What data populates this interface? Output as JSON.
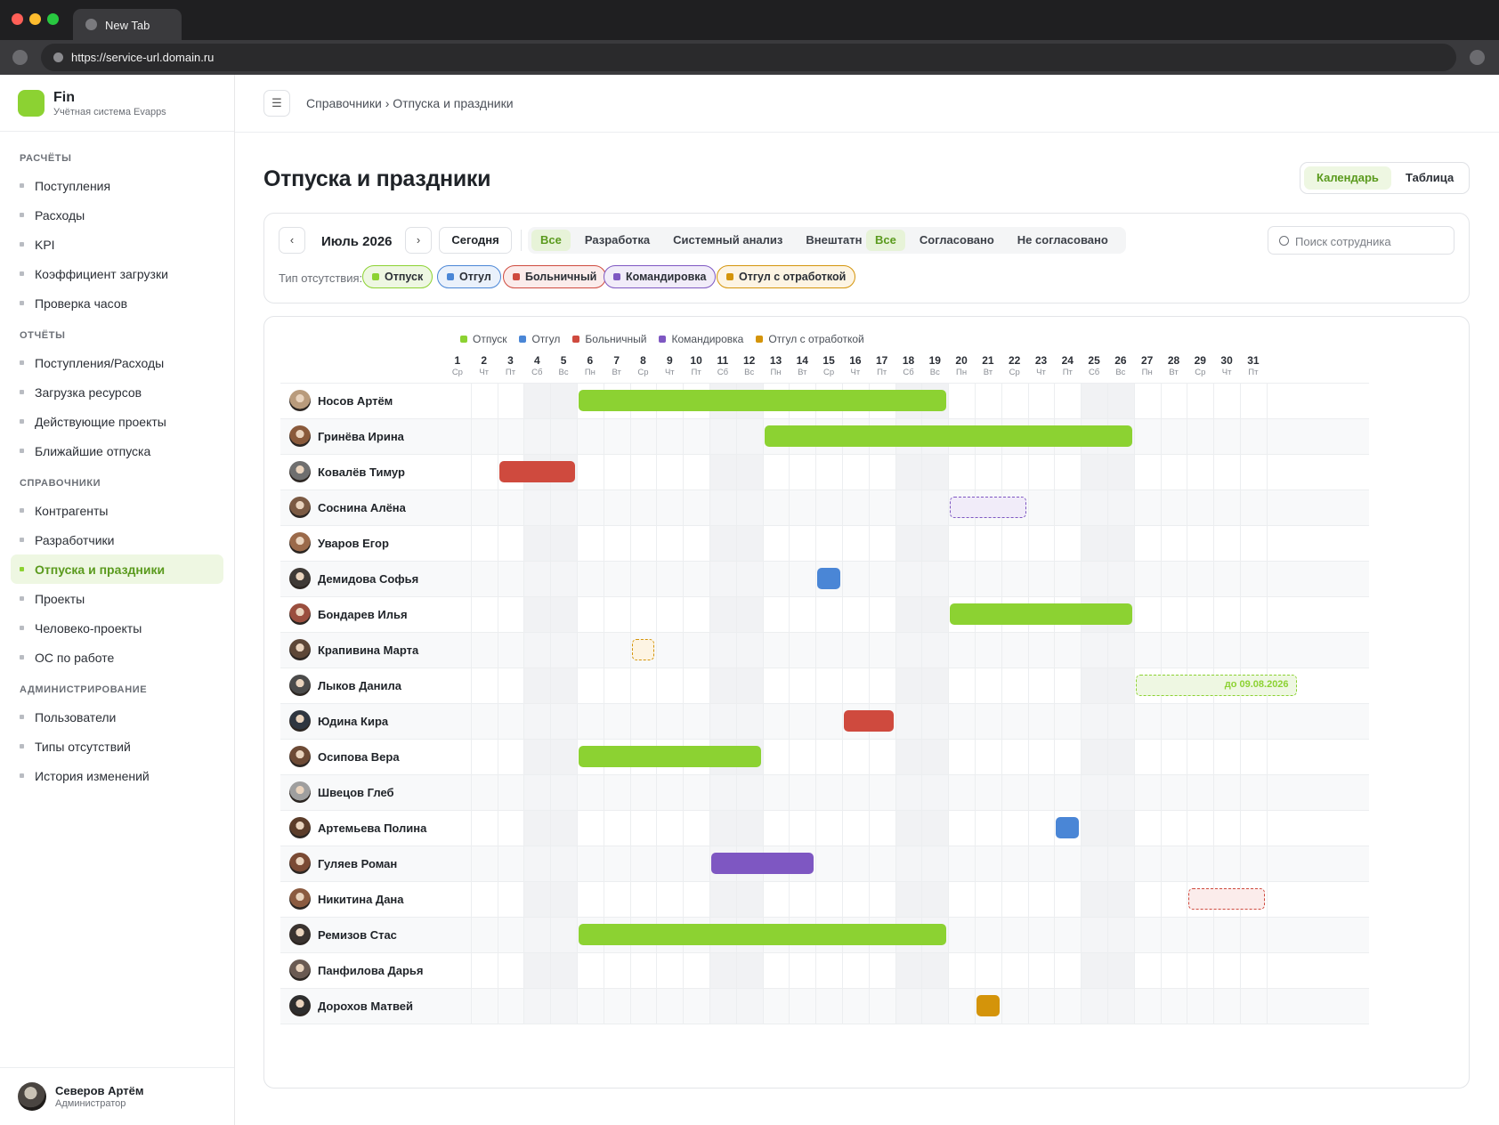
{
  "browser": {
    "tab_title": "New Tab",
    "url": "https://service-url.domain.ru"
  },
  "brand": {
    "name": "Fin",
    "subtitle": "Учётная система Evapps"
  },
  "sidebar": {
    "sections": [
      {
        "title": "РАСЧЁТЫ",
        "items": [
          "Поступления",
          "Расходы",
          "KPI",
          "Коэффициент загрузки",
          "Проверка часов"
        ]
      },
      {
        "title": "ОТЧЁТЫ",
        "items": [
          "Поступления/Расходы",
          "Загрузка ресурсов",
          "Действующие проекты",
          "Ближайшие отпуска"
        ]
      },
      {
        "title": "СПРАВОЧНИКИ",
        "items": [
          "Контрагенты",
          "Разработчики",
          "Отпуска и праздники",
          "Проекты",
          "Человеко-проекты",
          "ОС по работе"
        ]
      },
      {
        "title": "АДМИНИСТРИРОВАНИЕ",
        "items": [
          "Пользователи",
          "Типы отсутствий",
          "История изменений"
        ]
      }
    ],
    "active_item": "Отпуска и праздники"
  },
  "user": {
    "name": "Северов Артём",
    "role": "Администратор"
  },
  "topbar": {
    "menu_icon": "☰",
    "breadcrumb": "Справочники › Отпуска и праздники"
  },
  "page": {
    "title": "Отпуска и праздники",
    "view_calendar": "Календарь",
    "view_table": "Таблица",
    "active_view": "Календарь"
  },
  "filters": {
    "prev": "‹",
    "next": "›",
    "month": "Июль 2026",
    "today": "Сегодня",
    "departments": [
      "Все",
      "Разработка",
      "Системный анализ",
      "Внештатные"
    ],
    "department_active": "Все",
    "statuses": [
      "Все",
      "Согласовано",
      "Не согласовано"
    ],
    "status_active": "Все",
    "search_placeholder": "Поиск сотрудника",
    "absence_type_label": "Тип отсутствия:"
  },
  "absence_types": [
    {
      "key": "vacation",
      "label": "Отпуск",
      "color": "#8cd232",
      "chip_bg": "#eef7e2",
      "chip_border": "#8cd232"
    },
    {
      "key": "dayoff",
      "label": "Отгул",
      "color": "#4a86d6",
      "chip_bg": "#eaf1fb",
      "chip_border": "#4a86d6"
    },
    {
      "key": "sick",
      "label": "Больничный",
      "color": "#cf4a3e",
      "chip_bg": "#fbeceb",
      "chip_border": "#cf4a3e"
    },
    {
      "key": "trip",
      "label": "Командировка",
      "color": "#7e57c2",
      "chip_bg": "#f1ecf9",
      "chip_border": "#7e57c2"
    },
    {
      "key": "workoff",
      "label": "Отгул с отработкой",
      "color": "#d4940a",
      "chip_bg": "#fdf4e3",
      "chip_border": "#d4940a"
    }
  ],
  "calendar": {
    "days": [
      {
        "d": "1",
        "w": "Ср"
      },
      {
        "d": "2",
        "w": "Чт"
      },
      {
        "d": "3",
        "w": "Пт"
      },
      {
        "d": "4",
        "w": "Сб"
      },
      {
        "d": "5",
        "w": "Вс"
      },
      {
        "d": "6",
        "w": "Пн"
      },
      {
        "d": "7",
        "w": "Вт"
      },
      {
        "d": "8",
        "w": "Ср"
      },
      {
        "d": "9",
        "w": "Чт"
      },
      {
        "d": "10",
        "w": "Пт"
      },
      {
        "d": "11",
        "w": "Сб"
      },
      {
        "d": "12",
        "w": "Вс"
      },
      {
        "d": "13",
        "w": "Пн"
      },
      {
        "d": "14",
        "w": "Вт"
      },
      {
        "d": "15",
        "w": "Ср"
      },
      {
        "d": "16",
        "w": "Чт"
      },
      {
        "d": "17",
        "w": "Пт"
      },
      {
        "d": "18",
        "w": "Сб"
      },
      {
        "d": "19",
        "w": "Вс"
      },
      {
        "d": "20",
        "w": "Пн"
      },
      {
        "d": "21",
        "w": "Вт"
      },
      {
        "d": "22",
        "w": "Ср"
      },
      {
        "d": "23",
        "w": "Чт"
      },
      {
        "d": "24",
        "w": "Пт"
      },
      {
        "d": "25",
        "w": "Сб"
      },
      {
        "d": "26",
        "w": "Вс"
      },
      {
        "d": "27",
        "w": "Пн"
      },
      {
        "d": "28",
        "w": "Вт"
      },
      {
        "d": "29",
        "w": "Ср"
      },
      {
        "d": "30",
        "w": "Чт"
      },
      {
        "d": "31",
        "w": "Пт"
      }
    ],
    "weekend_pairs": [
      [
        4,
        5
      ],
      [
        11,
        12
      ],
      [
        18,
        19
      ],
      [
        25,
        26
      ]
    ],
    "employees": [
      {
        "name": "Носов Артём",
        "avatar": "#b99b7c",
        "absences": [
          {
            "type": "vacation",
            "from": 6,
            "to": 19,
            "approved": true
          }
        ]
      },
      {
        "name": "Гринёва Ирина",
        "avatar": "#8a5a3b",
        "absences": [
          {
            "type": "vacation",
            "from": 13,
            "to": 26,
            "approved": true
          }
        ]
      },
      {
        "name": "Ковалёв Тимур",
        "avatar": "#6f6f6f",
        "absences": [
          {
            "type": "sick",
            "from": 3,
            "to": 5,
            "approved": true
          }
        ]
      },
      {
        "name": "Соснина Алёна",
        "avatar": "#7b5a43",
        "absences": [
          {
            "type": "trip",
            "from": 20,
            "to": 22,
            "approved": false
          }
        ]
      },
      {
        "name": "Уваров Егор",
        "avatar": "#9b6a4a",
        "absences": []
      },
      {
        "name": "Демидова Софья",
        "avatar": "#3f3a36",
        "absences": [
          {
            "type": "dayoff",
            "from": 15,
            "to": 15,
            "approved": true
          }
        ]
      },
      {
        "name": "Бондарев Илья",
        "avatar": "#9a4e3e",
        "absences": [
          {
            "type": "vacation",
            "from": 20,
            "to": 26,
            "approved": true
          }
        ]
      },
      {
        "name": "Крапивина Марта",
        "avatar": "#5d4737",
        "absences": [
          {
            "type": "workoff",
            "from": 8,
            "to": 8,
            "approved": false
          }
        ]
      },
      {
        "name": "Лыков Данила",
        "avatar": "#4b4b4b",
        "absences": [
          {
            "type": "vacation",
            "from": 27,
            "to": 32.2,
            "approved": false,
            "label": "до 09.08.2026"
          }
        ]
      },
      {
        "name": "Юдина Кира",
        "avatar": "#2f3640",
        "absences": [
          {
            "type": "sick",
            "from": 16,
            "to": 17,
            "approved": true
          }
        ]
      },
      {
        "name": "Осипова Вера",
        "avatar": "#6d4a35",
        "absences": [
          {
            "type": "vacation",
            "from": 6,
            "to": 12,
            "approved": true
          }
        ]
      },
      {
        "name": "Швецов Глеб",
        "avatar": "#9f9f9f",
        "absences": []
      },
      {
        "name": "Артемьева Полина",
        "avatar": "#5c3d2a",
        "absences": [
          {
            "type": "dayoff",
            "from": 24,
            "to": 24,
            "approved": true
          }
        ]
      },
      {
        "name": "Гуляев Роман",
        "avatar": "#7a4a34",
        "absences": [
          {
            "type": "trip",
            "from": 11,
            "to": 14,
            "approved": true
          }
        ]
      },
      {
        "name": "Никитина Дана",
        "avatar": "#8b5b40",
        "absences": [
          {
            "type": "sick",
            "from": 29,
            "to": 31,
            "approved": false
          }
        ]
      },
      {
        "name": "Ремизов Стас",
        "avatar": "#3a3330",
        "absences": [
          {
            "type": "vacation",
            "from": 6,
            "to": 19,
            "approved": true
          }
        ]
      },
      {
        "name": "Панфилова Дарья",
        "avatar": "#6a5a52",
        "absences": []
      },
      {
        "name": "Дорохов Матвей",
        "avatar": "#2e2e2e",
        "absences": [
          {
            "type": "workoff",
            "from": 21,
            "to": 21,
            "approved": true
          }
        ]
      }
    ]
  }
}
